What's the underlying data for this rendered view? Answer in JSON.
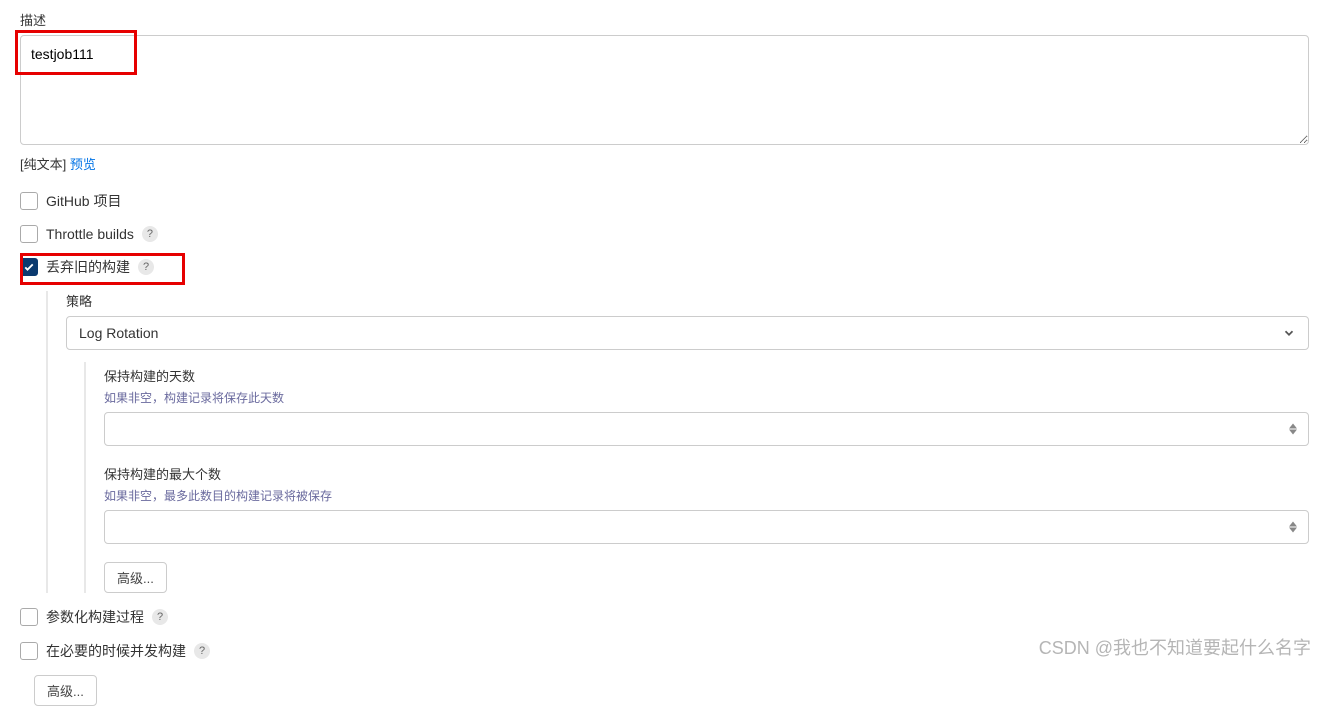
{
  "desc": {
    "label": "描述",
    "value": "testjob111",
    "hint_prefix": "[纯文本]",
    "preview_link": "预览"
  },
  "checkboxes": {
    "github": {
      "label": "GitHub 项目",
      "checked": false
    },
    "throttle": {
      "label": "Throttle builds",
      "checked": false,
      "help": "?"
    },
    "discard": {
      "label": "丢弃旧的构建",
      "checked": true,
      "help": "?"
    },
    "parameterized": {
      "label": "参数化构建过程",
      "checked": false,
      "help": "?"
    },
    "concurrent": {
      "label": "在必要的时候并发构建",
      "checked": false,
      "help": "?"
    }
  },
  "strategy": {
    "label": "策略",
    "select_value": "Log Rotation",
    "days": {
      "label": "保持构建的天数",
      "hint": "如果非空，构建记录将保存此天数",
      "value": ""
    },
    "max": {
      "label": "保持构建的最大个数",
      "hint": "如果非空，最多此数目的构建记录将被保存",
      "value": ""
    },
    "adv_btn": "高级..."
  },
  "bottom_adv_btn": "高级...",
  "watermark": "CSDN @我也不知道要起什么名字"
}
